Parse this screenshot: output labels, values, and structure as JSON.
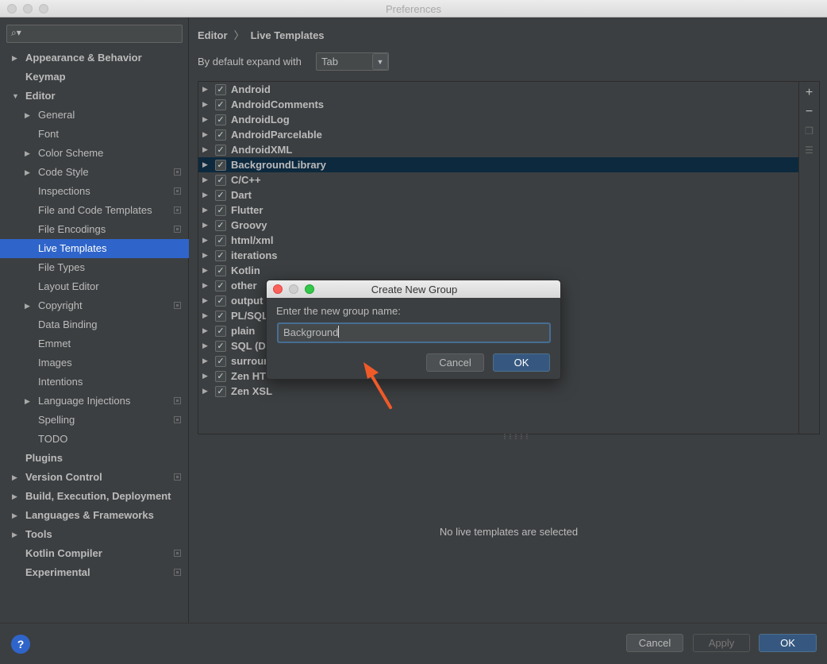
{
  "window": {
    "title": "Preferences"
  },
  "search": {
    "placeholder": ""
  },
  "sidebar": {
    "items": [
      {
        "label": "Appearance & Behavior",
        "level": 0,
        "arrow": "▶",
        "bold": true
      },
      {
        "label": "Keymap",
        "level": 0,
        "arrow": "",
        "bold": true
      },
      {
        "label": "Editor",
        "level": 0,
        "arrow": "▼",
        "bold": true
      },
      {
        "label": "General",
        "level": 1,
        "arrow": "▶"
      },
      {
        "label": "Font",
        "level": 1,
        "arrow": ""
      },
      {
        "label": "Color Scheme",
        "level": 1,
        "arrow": "▶"
      },
      {
        "label": "Code Style",
        "level": 1,
        "arrow": "▶",
        "project": true
      },
      {
        "label": "Inspections",
        "level": 1,
        "arrow": "",
        "project": true
      },
      {
        "label": "File and Code Templates",
        "level": 1,
        "arrow": "",
        "project": true
      },
      {
        "label": "File Encodings",
        "level": 1,
        "arrow": "",
        "project": true
      },
      {
        "label": "Live Templates",
        "level": 1,
        "arrow": "",
        "selected": true
      },
      {
        "label": "File Types",
        "level": 1,
        "arrow": ""
      },
      {
        "label": "Layout Editor",
        "level": 1,
        "arrow": ""
      },
      {
        "label": "Copyright",
        "level": 1,
        "arrow": "▶",
        "project": true
      },
      {
        "label": "Data Binding",
        "level": 1,
        "arrow": ""
      },
      {
        "label": "Emmet",
        "level": 1,
        "arrow": ""
      },
      {
        "label": "Images",
        "level": 1,
        "arrow": ""
      },
      {
        "label": "Intentions",
        "level": 1,
        "arrow": ""
      },
      {
        "label": "Language Injections",
        "level": 1,
        "arrow": "▶",
        "project": true
      },
      {
        "label": "Spelling",
        "level": 1,
        "arrow": "",
        "project": true
      },
      {
        "label": "TODO",
        "level": 1,
        "arrow": ""
      },
      {
        "label": "Plugins",
        "level": 0,
        "arrow": "",
        "bold": true
      },
      {
        "label": "Version Control",
        "level": 0,
        "arrow": "▶",
        "bold": true,
        "project": true
      },
      {
        "label": "Build, Execution, Deployment",
        "level": 0,
        "arrow": "▶",
        "bold": true
      },
      {
        "label": "Languages & Frameworks",
        "level": 0,
        "arrow": "▶",
        "bold": true
      },
      {
        "label": "Tools",
        "level": 0,
        "arrow": "▶",
        "bold": true
      },
      {
        "label": "Kotlin Compiler",
        "level": 0,
        "arrow": "",
        "bold": true,
        "project": true
      },
      {
        "label": "Experimental",
        "level": 0,
        "arrow": "",
        "bold": true,
        "project": true
      }
    ]
  },
  "breadcrumb": {
    "part1": "Editor",
    "separator": "〉",
    "part2": "Live Templates"
  },
  "expand": {
    "label": "By default expand with",
    "value": "Tab"
  },
  "template_groups": [
    {
      "label": "Android"
    },
    {
      "label": "AndroidComments"
    },
    {
      "label": "AndroidLog"
    },
    {
      "label": "AndroidParcelable"
    },
    {
      "label": "AndroidXML"
    },
    {
      "label": "BackgroundLibrary",
      "selected": true
    },
    {
      "label": "C/C++"
    },
    {
      "label": "Dart"
    },
    {
      "label": "Flutter"
    },
    {
      "label": "Groovy"
    },
    {
      "label": "html/xml"
    },
    {
      "label": "iterations"
    },
    {
      "label": "Kotlin"
    },
    {
      "label": "other"
    },
    {
      "label": "output"
    },
    {
      "label": "PL/SQL"
    },
    {
      "label": "plain"
    },
    {
      "label": "SQL (D"
    },
    {
      "label": "surrour"
    },
    {
      "label": "Zen HT"
    },
    {
      "label": "Zen XSL"
    }
  ],
  "side_toolbar": {
    "add": "+",
    "remove": "−"
  },
  "empty_message": "No live templates are selected",
  "dialog": {
    "title": "Create New Group",
    "label": "Enter the new group name:",
    "value": "Background",
    "cancel": "Cancel",
    "ok": "OK"
  },
  "footer": {
    "help": "?",
    "cancel": "Cancel",
    "apply": "Apply",
    "ok": "OK"
  },
  "colors": {
    "selection": "#2f65ca",
    "tree_selection": "#0d293e",
    "primary_button": "#365880",
    "annotation_arrow": "#f05a28"
  }
}
